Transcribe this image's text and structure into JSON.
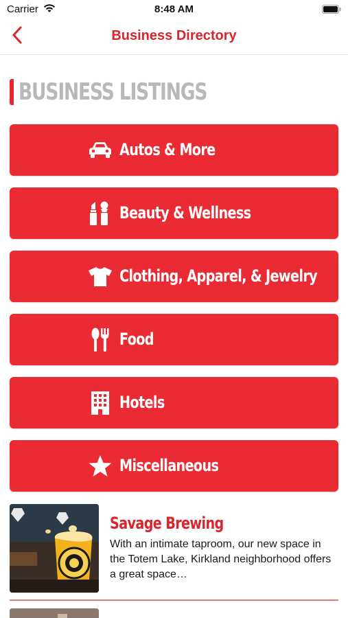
{
  "status_bar": {
    "carrier": "Carrier",
    "time": "8:48 AM"
  },
  "nav": {
    "title": "Business Directory",
    "back_icon": "chevron-left-icon"
  },
  "section": {
    "heading": "BUSINESS LISTINGS"
  },
  "categories": [
    {
      "label": "Autos & More",
      "icon": "car-icon"
    },
    {
      "label": "Beauty & Wellness",
      "icon": "cosmetics-icon"
    },
    {
      "label": "Clothing, Apparel, & Jewelry",
      "icon": "tshirt-icon"
    },
    {
      "label": "Food",
      "icon": "utensils-icon"
    },
    {
      "label": "Hotels",
      "icon": "building-icon"
    },
    {
      "label": "Miscellaneous",
      "icon": "star-icon"
    }
  ],
  "featured": {
    "name": "Savage Brewing",
    "description": "With an intimate taproom, our new space in the Totem Lake, Kirkland neighborhood offers a great space…"
  },
  "colors": {
    "accent": "#ea2b33",
    "title_red": "#d9262c",
    "heading_gray": "#b8b8b8"
  }
}
